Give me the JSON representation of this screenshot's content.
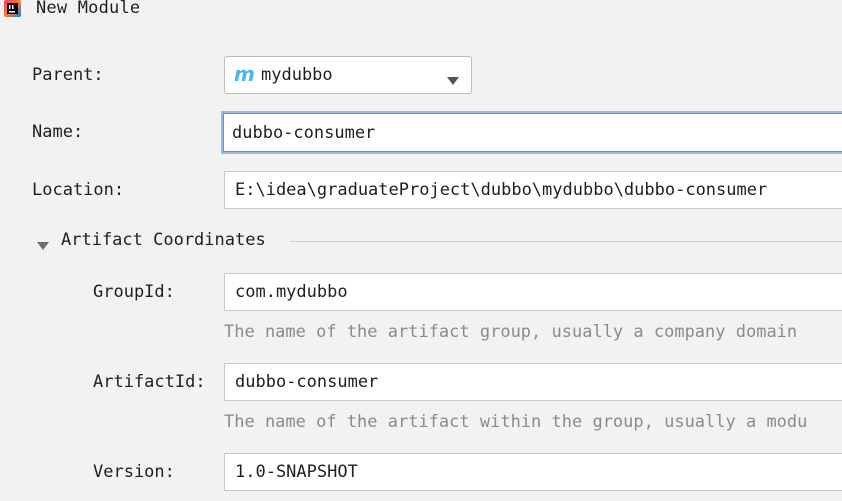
{
  "window": {
    "title": "New Module"
  },
  "form": {
    "parent": {
      "label": "Parent:",
      "value": "mydubbo"
    },
    "name": {
      "label": "Name:",
      "value": "dubbo-consumer"
    },
    "location": {
      "label": "Location:",
      "value": "E:\\idea\\graduateProject\\dubbo\\mydubbo\\dubbo-consumer"
    }
  },
  "artifact": {
    "section_title": "Artifact Coordinates",
    "groupId": {
      "label": "GroupId:",
      "value": "com.mydubbo",
      "hint": "The name of the artifact group, usually a company domain"
    },
    "artifactId": {
      "label": "ArtifactId:",
      "value": "dubbo-consumer",
      "hint": "The name of the artifact within the group, usually a modu"
    },
    "version": {
      "label": "Version:",
      "value": "1.0-SNAPSHOT"
    }
  },
  "icons": {
    "app": "intellij-idea-icon",
    "parent": "maven-m-icon",
    "dropdown": "chevron-down-icon",
    "section": "triangle-down-icon"
  },
  "colors": {
    "background": "#f2f2f2",
    "focus_border": "#97b9e2",
    "hint_text": "#8b8b8b",
    "maven_icon": "#4cb8e6"
  }
}
